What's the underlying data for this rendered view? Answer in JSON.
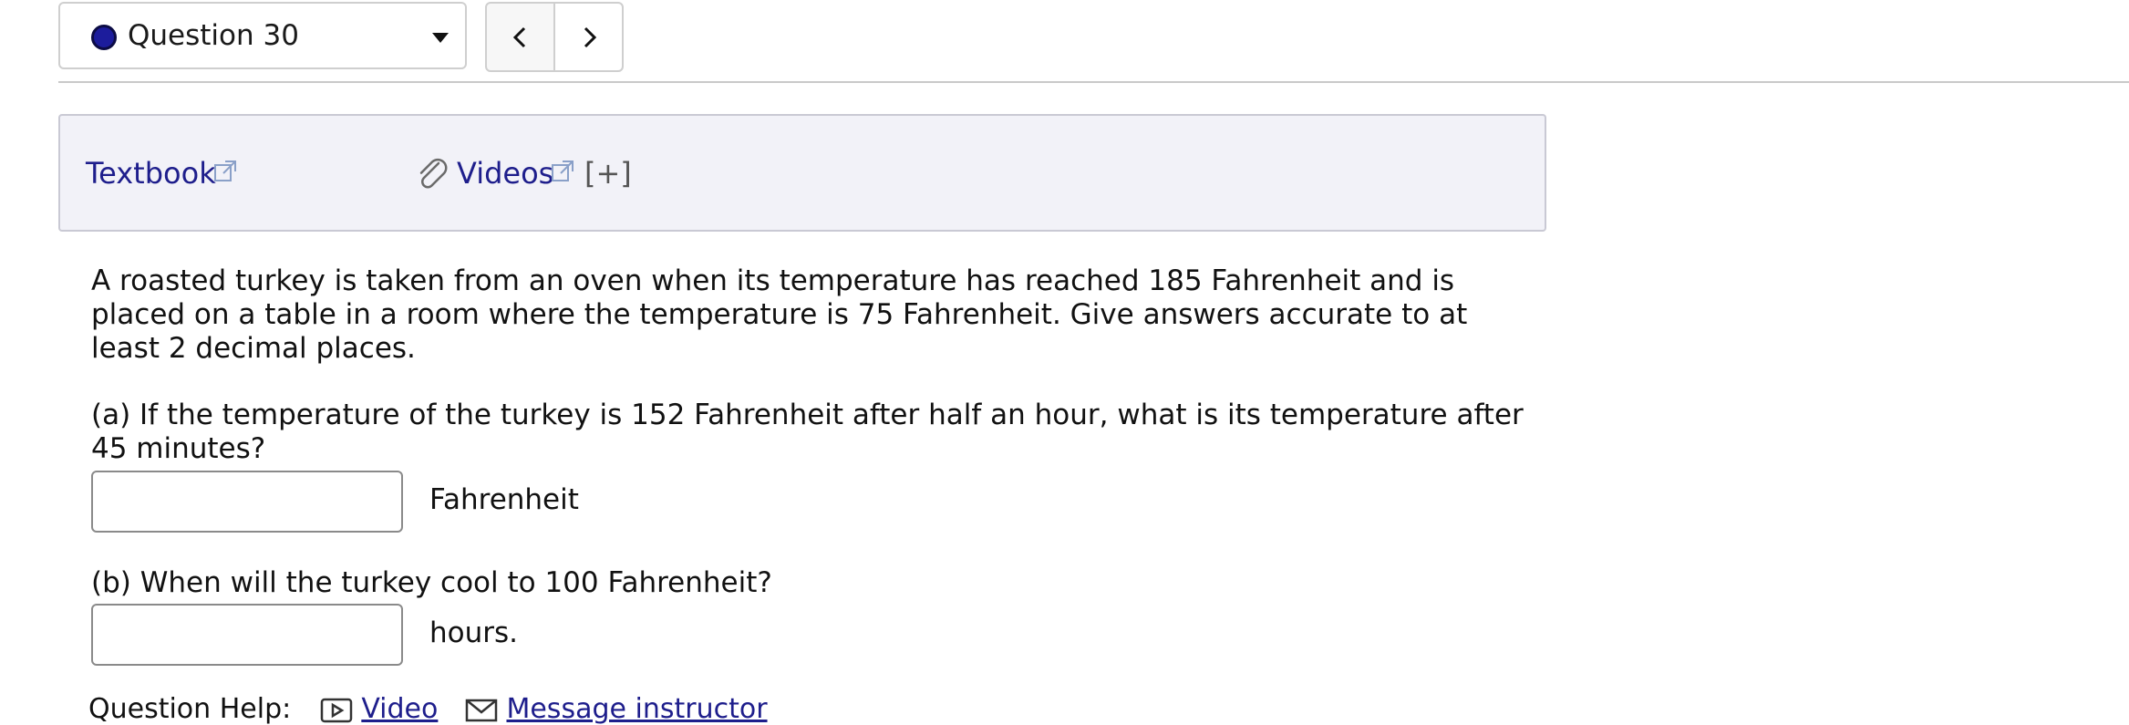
{
  "nav": {
    "question_label": "Question 30",
    "status_color": "#1c1c9c",
    "prev_icon": "chevron-left-icon",
    "next_icon": "chevron-right-icon"
  },
  "resources": {
    "textbook_label": "Textbook",
    "videos_label": "Videos",
    "expand_label": "[+]"
  },
  "problem": {
    "intro": "A roasted turkey is taken from an oven when its temperature has reached 185 Fahrenheit and is placed on a table in a room where the temperature is 75 Fahrenheit. Give answers accurate to at least 2 decimal places.",
    "part_a": {
      "question": "(a) If the temperature of the turkey is 152 Fahrenheit after half an hour, what is its temperature after 45 minutes?",
      "value": "",
      "unit": "Fahrenheit"
    },
    "part_b": {
      "question": "(b) When will the turkey cool to 100 Fahrenheit?",
      "value": "",
      "unit": "hours."
    }
  },
  "help": {
    "label": "Question Help:",
    "video_label": "Video",
    "message_label": "Message instructor"
  },
  "colors": {
    "link": "#1e1e8c",
    "panel_bg": "#f2f2f8"
  }
}
